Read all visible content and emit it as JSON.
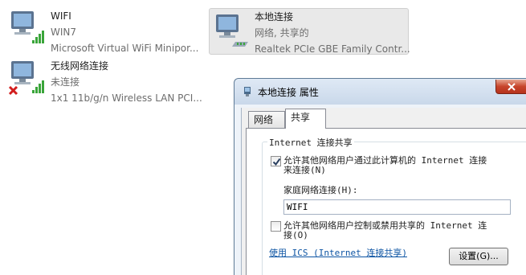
{
  "adapters": [
    {
      "name": "WIFI",
      "line2": "WIN7",
      "line3": "Microsoft Virtual WiFi Minipor...",
      "icon": "wireless-network-icon",
      "status": "connected"
    },
    {
      "name": "本地连接",
      "line2": "网络, 共享的",
      "line3": "Realtek PCIe GBE Family Contr...",
      "icon": "wired-network-icon",
      "status": "shared",
      "selected": true
    },
    {
      "name": "无线网络连接",
      "line2": "未连接",
      "line3": "1x1 11b/g/n Wireless LAN PCI...",
      "icon": "wireless-network-icon",
      "status": "disconnected"
    }
  ],
  "dialog": {
    "title": "本地连接 属性",
    "tabs": [
      {
        "label": "网络",
        "active": false
      },
      {
        "label": "共享",
        "active": true
      }
    ],
    "group_title": "Internet 连接共享",
    "option1": {
      "label_line1": "允许其他网络用户通过此计算机的 Internet 连接",
      "label_line2": "来连接(N)",
      "checked": true
    },
    "home_network_label": "家庭网络连接(H):",
    "home_network_value": "WIFI",
    "option2": {
      "label_line1": "允许其他网络用户控制或禁用共享的 Internet 连",
      "label_line2": "接(O)",
      "checked": false
    },
    "ics_link": "使用 ICS (Internet 连接共享)",
    "settings_button": "设置(G)..."
  },
  "colors": {
    "signal_green": "#3aa53a",
    "error_red": "#d21e1e",
    "link_blue": "#0d54a3",
    "close_red": "#c7452b"
  }
}
